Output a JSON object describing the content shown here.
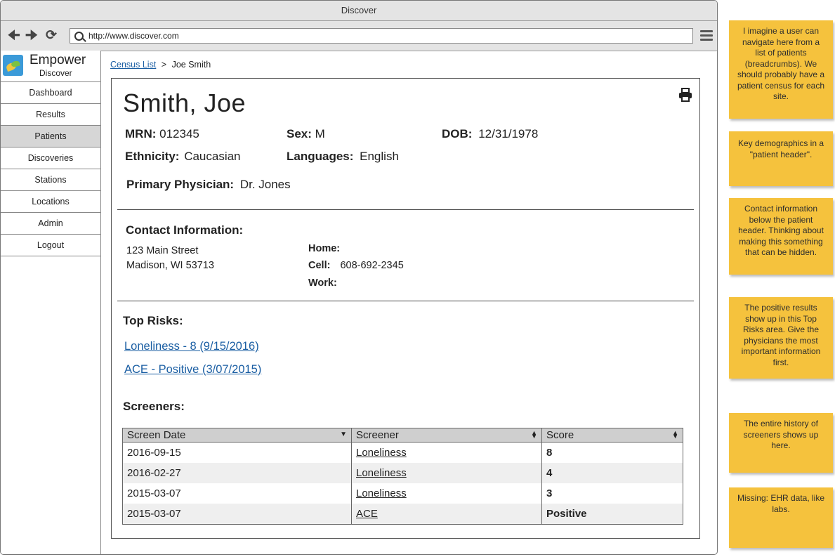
{
  "window": {
    "title": "Discover",
    "url": "http://www.discover.com"
  },
  "brand": {
    "name": "Empower",
    "subtitle": "Discover"
  },
  "sidebar": {
    "items": [
      {
        "label": "Dashboard"
      },
      {
        "label": "Results"
      },
      {
        "label": "Patients"
      },
      {
        "label": "Discoveries"
      },
      {
        "label": "Stations"
      },
      {
        "label": "Locations"
      },
      {
        "label": "Admin"
      },
      {
        "label": "Logout"
      }
    ]
  },
  "breadcrumb": {
    "parent": "Census List",
    "separator": ">",
    "current": "Joe Smith"
  },
  "patient": {
    "name": "Smith, Joe",
    "mrn_label": "MRN:",
    "mrn": "012345",
    "sex_label": "Sex:",
    "sex": "M",
    "dob_label": "DOB:",
    "dob": "12/31/1978",
    "ethnicity_label": "Ethnicity:",
    "ethnicity": "Caucasian",
    "languages_label": "Languages:",
    "languages": "English",
    "physician_label": "Primary Physician:",
    "physician": "Dr. Jones"
  },
  "contact": {
    "title": "Contact Information:",
    "address_line1": "123 Main Street",
    "address_line2": "Madison, WI 53713",
    "home_label": "Home:",
    "home": "",
    "cell_label": "Cell:",
    "cell": "608-692-2345",
    "work_label": "Work:",
    "work": ""
  },
  "risks": {
    "title": "Top Risks:",
    "items": [
      {
        "label": "Loneliness - 8  (9/15/2016)"
      },
      {
        "label": "ACE - Positive  (3/07/2015)"
      }
    ]
  },
  "screeners": {
    "title": "Screeners:",
    "columns": [
      "Screen Date",
      "Screener",
      "Score"
    ],
    "rows": [
      {
        "date": "2016-09-15",
        "screener": "Loneliness",
        "score": "8"
      },
      {
        "date": "2016-02-27",
        "screener": "Loneliness",
        "score": "4"
      },
      {
        "date": "2015-03-07",
        "screener": "Loneliness",
        "score": "3"
      },
      {
        "date": "2015-03-07",
        "screener": "ACE",
        "score": "Positive"
      }
    ]
  },
  "notes": [
    {
      "text": "I imagine a user can navigate here from a list of patients (breadcrumbs). We should probably have a patient census for each site."
    },
    {
      "text": "Key demographics in a \"patient header\"."
    },
    {
      "text": "Contact information below the patient header. Thinking about making this something that can be hidden."
    },
    {
      "text": "The positive results show up in this Top Risks area. Give the physicians the most important information first."
    },
    {
      "text": "The entire history of screeners shows up here."
    },
    {
      "text": "Missing: EHR data, like labs."
    }
  ],
  "colors": {
    "note": "#f5c23d",
    "link": "#1a5ea3",
    "active_menu": "#d6d6d6"
  }
}
